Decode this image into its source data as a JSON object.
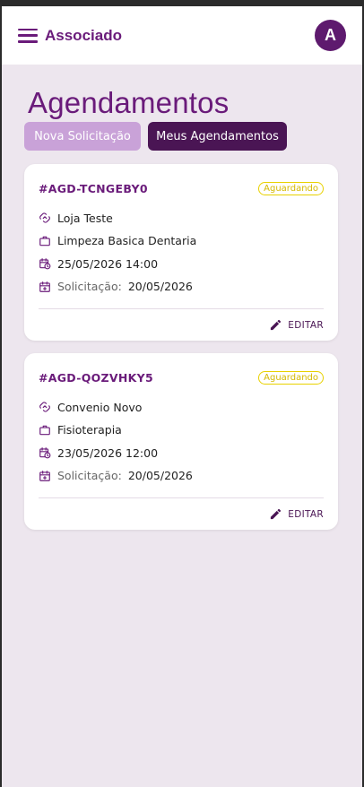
{
  "appbar": {
    "title": "Associado",
    "avatar_letter": "A"
  },
  "page": {
    "title": "Agendamentos"
  },
  "tabs": [
    {
      "label": "Nova Solicitação"
    },
    {
      "label": "Meus Agendamentos"
    }
  ],
  "cards": [
    {
      "code": "#AGD-TCNGEBY0",
      "status": "Aguardando",
      "provider": "Loja Teste",
      "service": "Limpeza Basica Dentaria",
      "datetime": "25/05/2026 14:00",
      "request_label": "Solicitação:",
      "request_date": "20/05/2026",
      "edit_label": "EDITAR"
    },
    {
      "code": "#AGD-QOZVHKY5",
      "status": "Aguardando",
      "provider": "Convenio Novo",
      "service": "Fisioterapia",
      "datetime": "23/05/2026 12:00",
      "request_label": "Solicitação:",
      "request_date": "20/05/2026",
      "edit_label": "EDITAR"
    }
  ],
  "colors": {
    "primary": "#6a1b7a",
    "primary_dark": "#4a1554",
    "primary_light": "#c9a2d8",
    "background": "#ede6ee",
    "status": "#d4b800"
  },
  "icons": {
    "menu": "menu-icon",
    "provider": "handshake-icon",
    "service": "briefcase-icon",
    "datetime": "calendar-clock-icon",
    "request": "calendar-plus-icon",
    "edit": "pencil-icon"
  }
}
